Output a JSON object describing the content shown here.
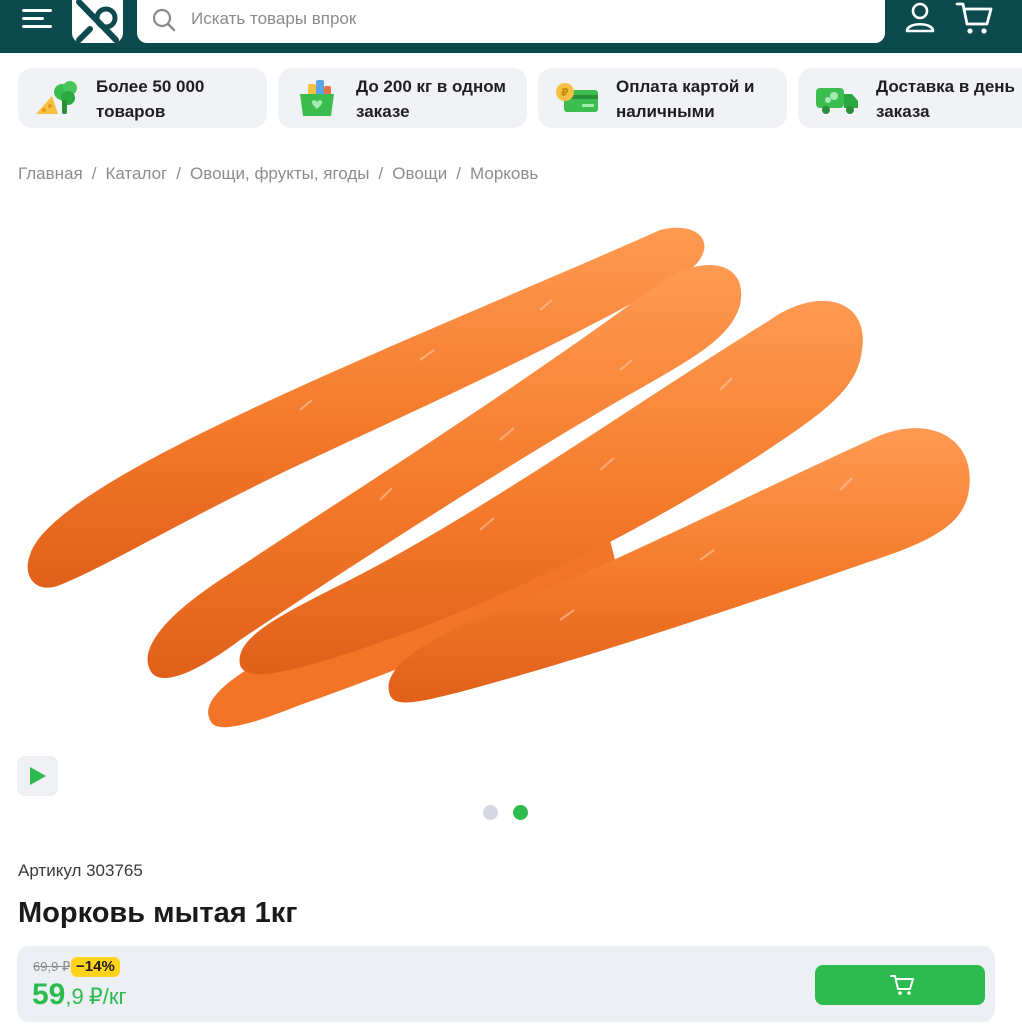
{
  "header": {
    "search_placeholder": "Искать товары впрок",
    "icons": [
      "menu-icon",
      "logo-icon",
      "search-icon",
      "user-icon",
      "cart-icon"
    ],
    "background": "#0c4a4e"
  },
  "features": [
    {
      "text": "Более 50 000\nтоваров",
      "icon": "vegetables-icon"
    },
    {
      "text": "До 200 кг в одном\nзаказе",
      "icon": "grocery-box-icon"
    },
    {
      "text": "Оплата картой и\nналичными",
      "icon": "card-coin-icon"
    },
    {
      "text": "Доставка в день\nзаказа",
      "icon": "delivery-truck-icon"
    }
  ],
  "breadcrumb": [
    "Главная",
    "Каталог",
    "Овощи, фрукты, ягоды",
    "Овощи",
    "Морковь"
  ],
  "gallery": {
    "slides": 2,
    "active": 2,
    "active_color": "#2dbb4f",
    "inactive_color": "#d6d9e3"
  },
  "product": {
    "article": "Артикул 303765",
    "title": "Морковь мытая 1кг",
    "old_price": "69,9 ₽",
    "discount": "−14%",
    "price_int": "59",
    "price_frac": ",9",
    "price_unit": "₽/кг"
  },
  "colors": {
    "accent": "#2dbb4f",
    "badge": "#ffd31a",
    "card_bg": "#f1f2f6"
  }
}
